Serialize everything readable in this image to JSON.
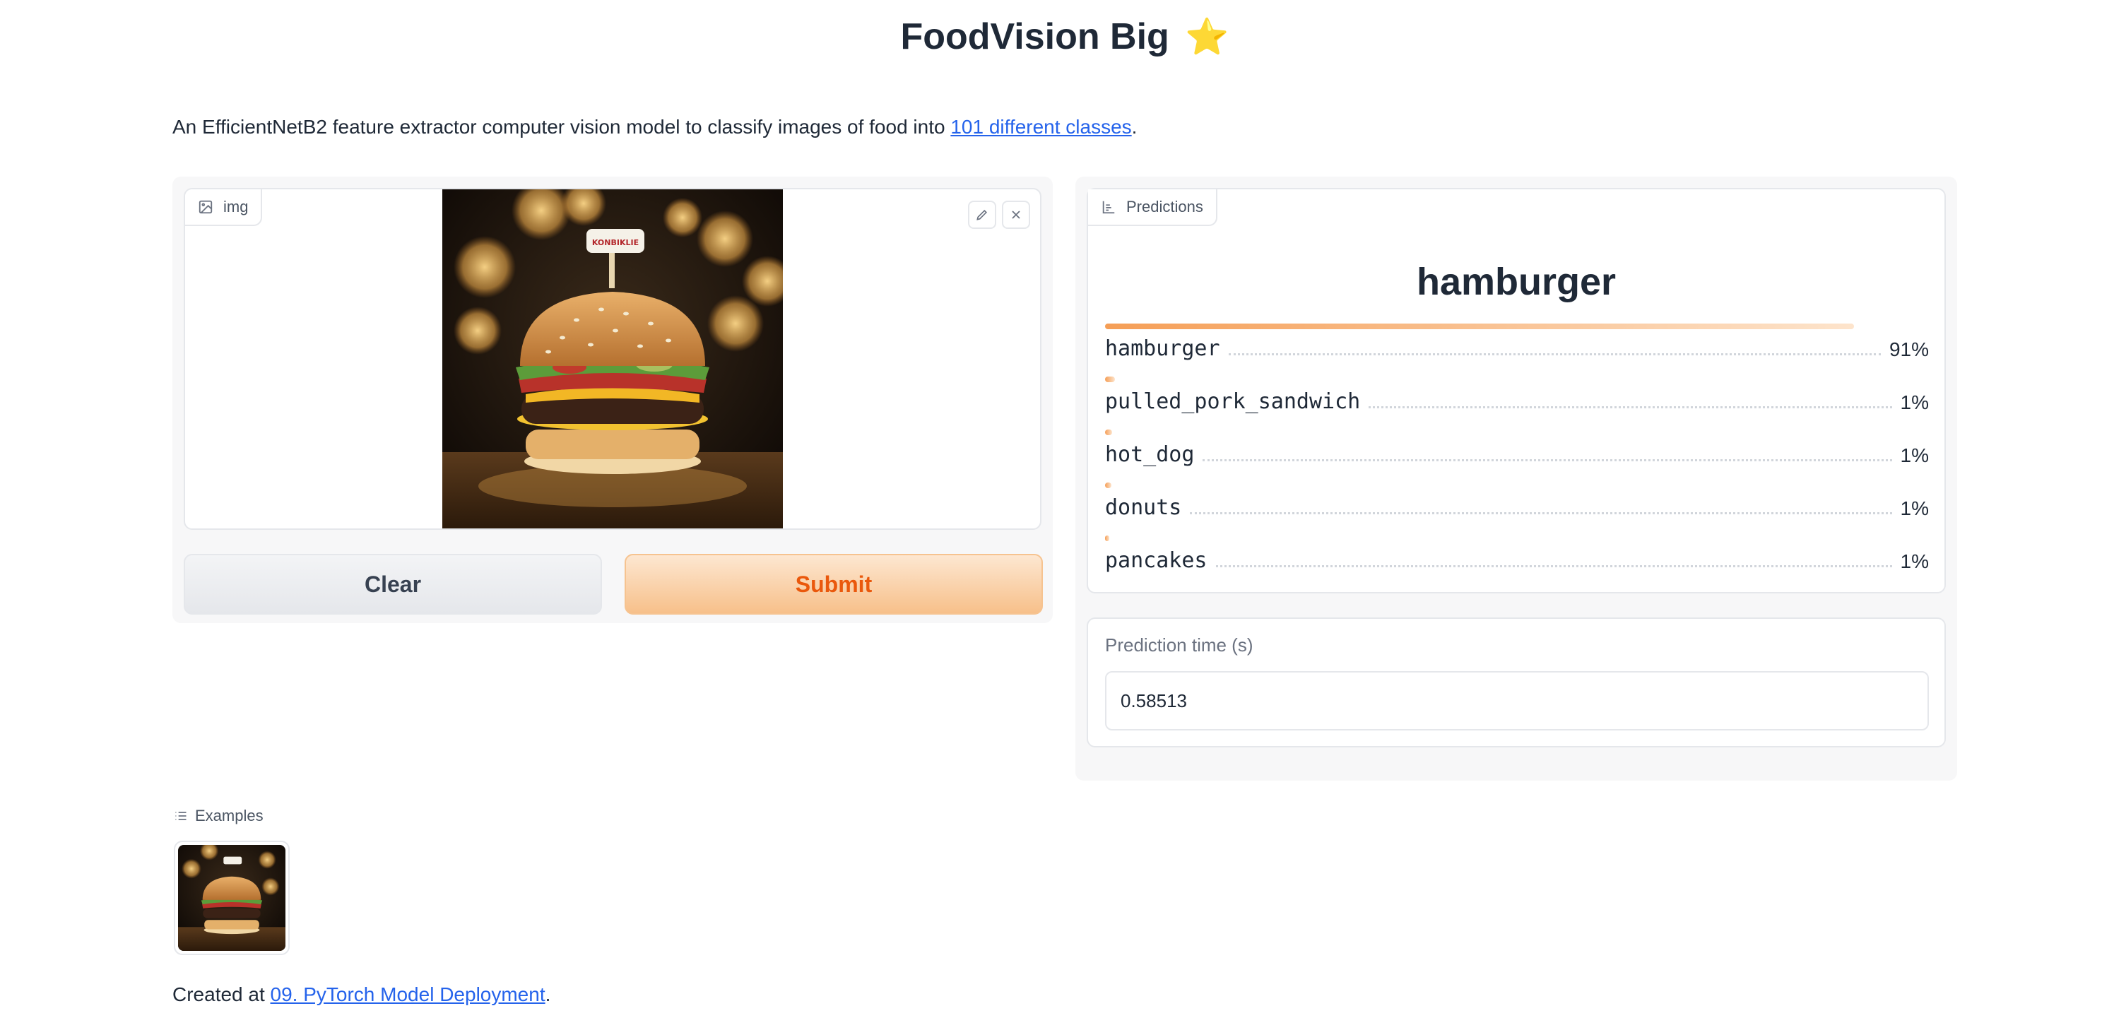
{
  "header": {
    "title": "FoodVision Big",
    "title_emoji": "⭐"
  },
  "description": {
    "prefix": "An EfficientNetB2 feature extractor computer vision model to classify images of food into ",
    "link_text": "101 different classes",
    "suffix": "."
  },
  "input": {
    "label": "img",
    "photo_sign_text": "KONBIKLIE",
    "clear_label": "Clear",
    "submit_label": "Submit"
  },
  "predictions": {
    "label": "Predictions",
    "top_label": "hamburger",
    "confidences": [
      {
        "label": "hamburger",
        "pct": "91%",
        "value": 0.91
      },
      {
        "label": "pulled_pork_sandwich",
        "pct": "1%",
        "value": 0.012
      },
      {
        "label": "hot_dog",
        "pct": "1%",
        "value": 0.009
      },
      {
        "label": "donuts",
        "pct": "1%",
        "value": 0.008
      },
      {
        "label": "pancakes",
        "pct": "1%",
        "value": 0.005
      }
    ]
  },
  "prediction_time": {
    "label": "Prediction time (s)",
    "value": "0.58513"
  },
  "examples": {
    "label": "Examples"
  },
  "footer": {
    "prefix": "Created at ",
    "link_text": "09. PyTorch Model Deployment",
    "suffix": "."
  },
  "colors": {
    "accent": "#f97316",
    "link": "#2563eb",
    "submit_text": "#ea580c"
  }
}
